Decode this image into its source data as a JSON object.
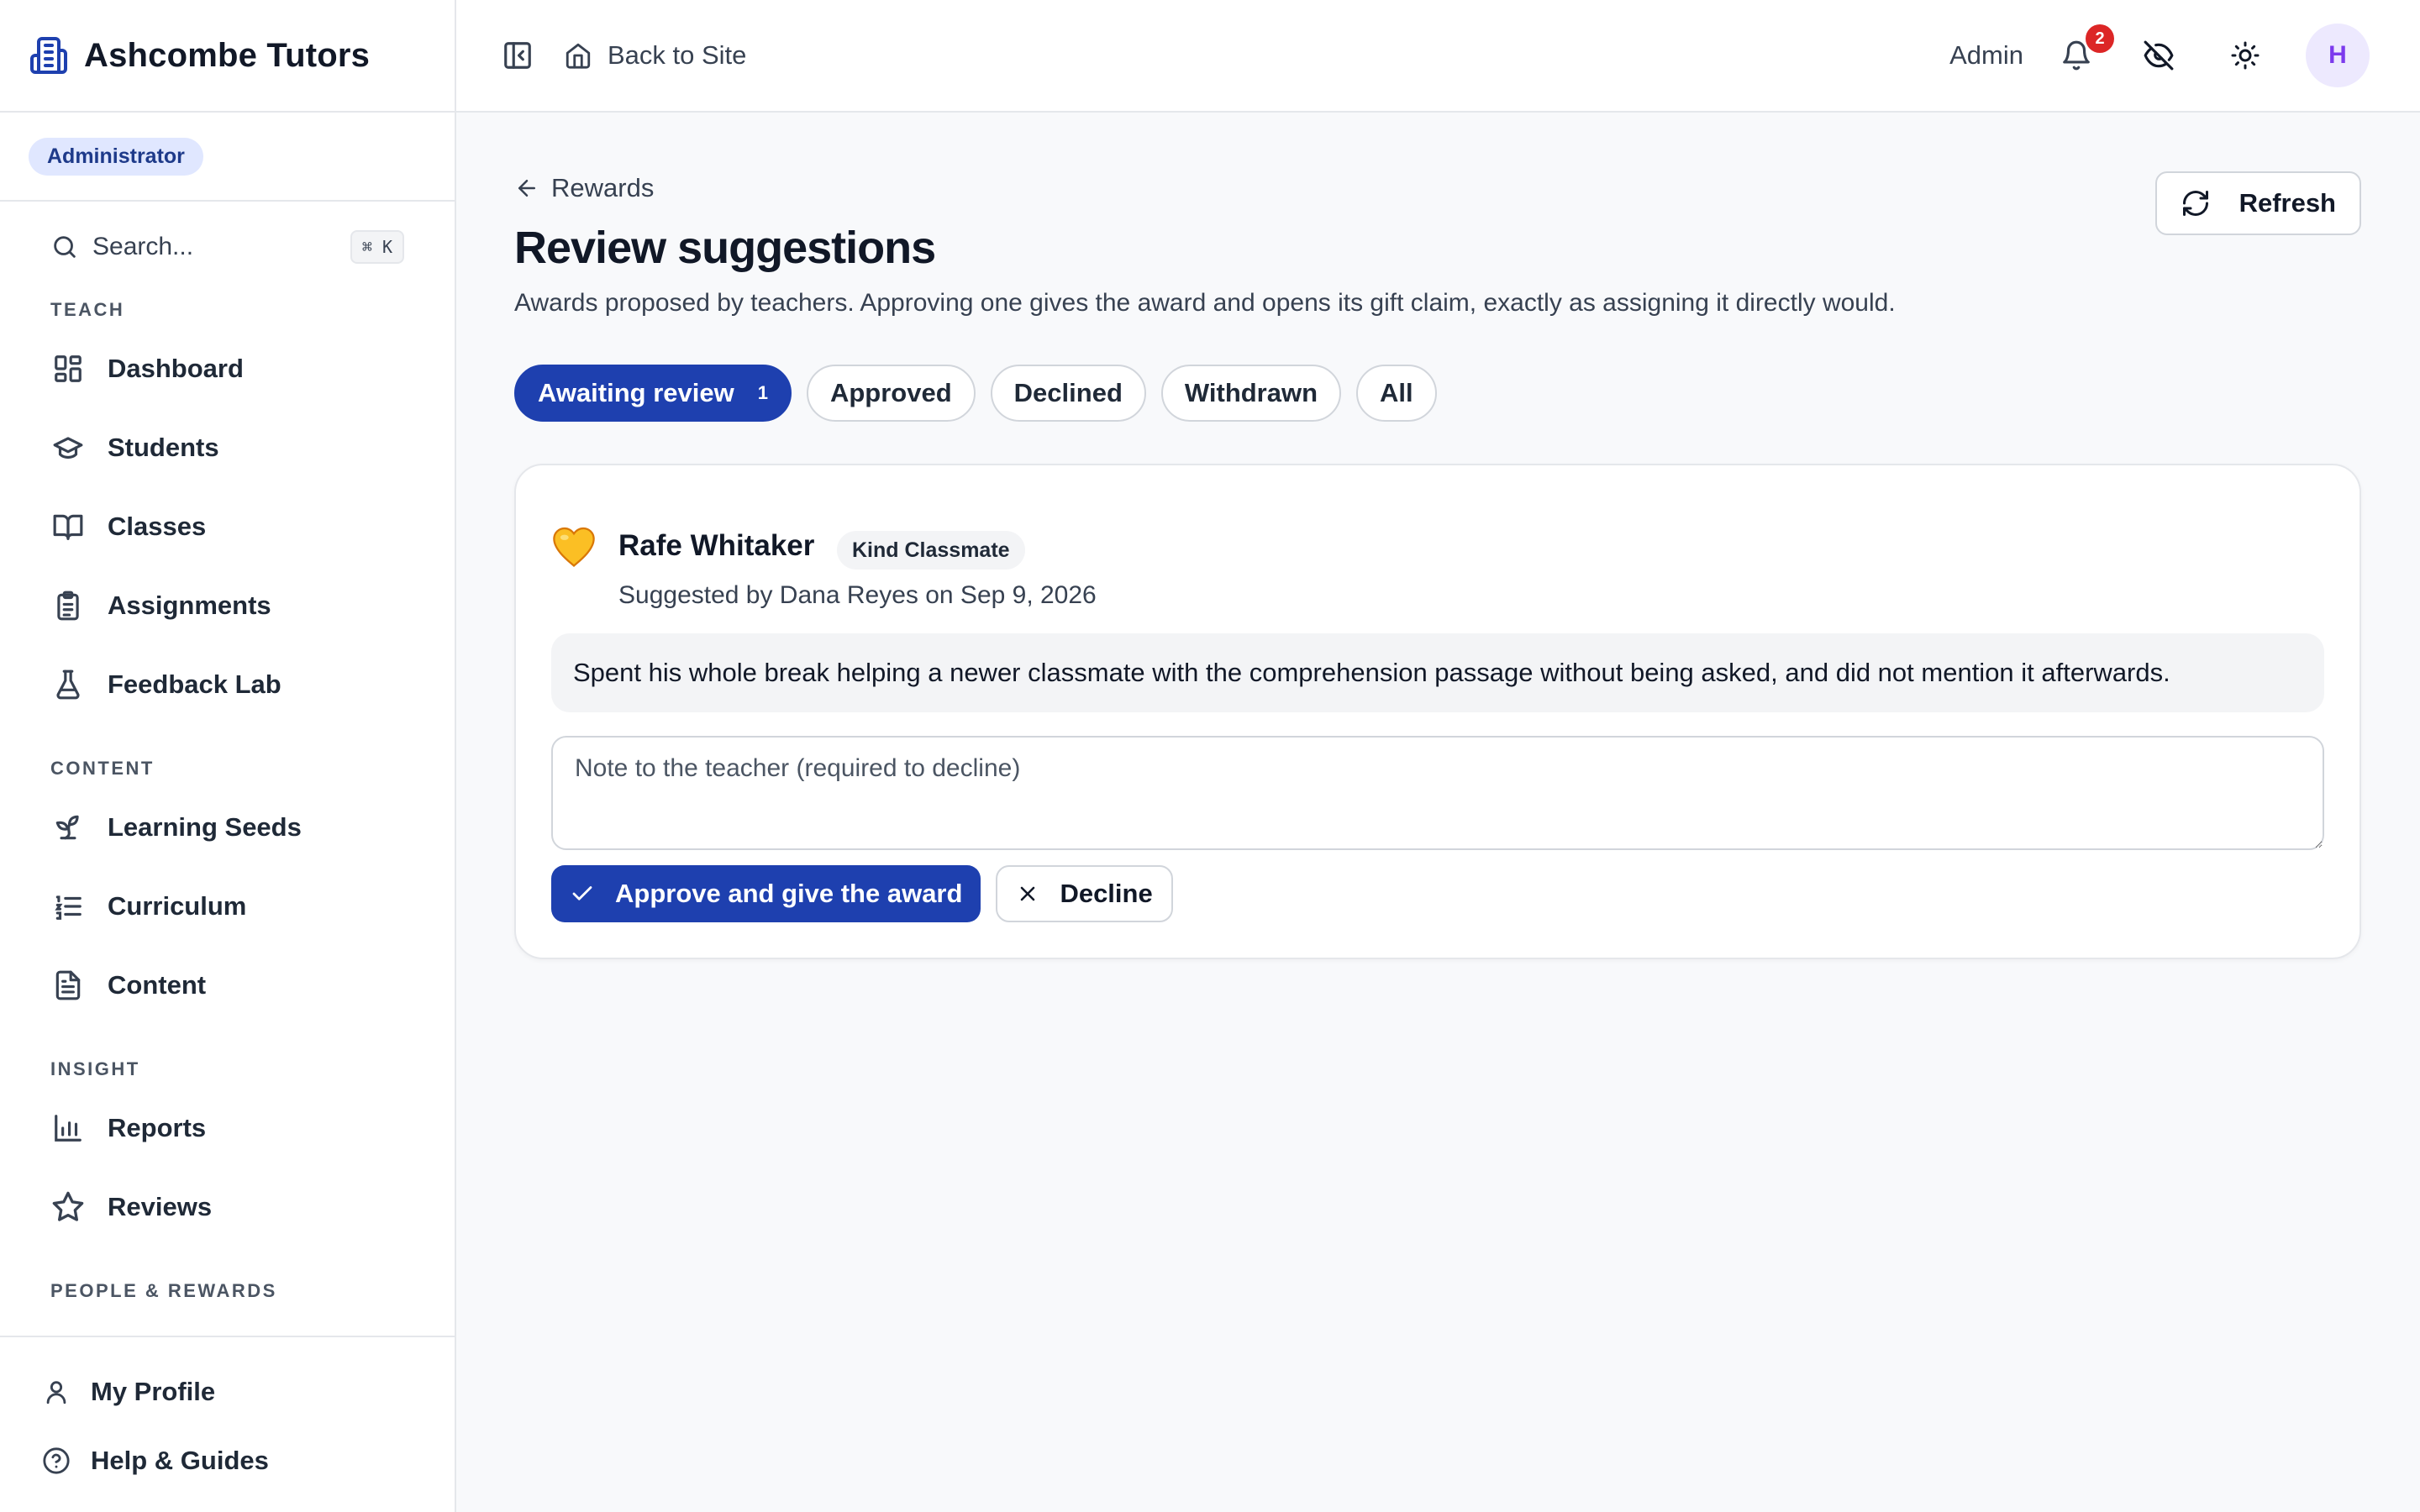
{
  "brand": {
    "name": "Ashcombe Tutors",
    "icon": "building-icon",
    "accent": "#1e40af"
  },
  "role": {
    "label": "Administrator"
  },
  "search": {
    "placeholder": "Search...",
    "shortcut": "⌘ K"
  },
  "sidebar": {
    "sections": [
      {
        "title": "TEACH",
        "items": [
          {
            "label": "Dashboard",
            "icon": "dashboard-icon"
          },
          {
            "label": "Students",
            "icon": "graduation-cap-icon"
          },
          {
            "label": "Classes",
            "icon": "book-open-icon"
          },
          {
            "label": "Assignments",
            "icon": "clipboard-icon"
          },
          {
            "label": "Feedback Lab",
            "icon": "flask-icon"
          }
        ]
      },
      {
        "title": "CONTENT",
        "items": [
          {
            "label": "Learning Seeds",
            "icon": "sprout-icon"
          },
          {
            "label": "Curriculum",
            "icon": "list-ordered-icon"
          },
          {
            "label": "Content",
            "icon": "file-text-icon"
          }
        ]
      },
      {
        "title": "INSIGHT",
        "items": [
          {
            "label": "Reports",
            "icon": "bar-chart-icon"
          },
          {
            "label": "Reviews",
            "icon": "star-icon"
          }
        ]
      },
      {
        "title": "PEOPLE & REWARDS",
        "items": []
      }
    ],
    "footer": [
      {
        "label": "My Profile",
        "icon": "user-icon"
      },
      {
        "label": "Help & Guides",
        "icon": "help-circle-icon"
      }
    ]
  },
  "topbar": {
    "back_label": "Back to Site",
    "admin_label": "Admin",
    "notification_count": "2",
    "avatar_initial": "H"
  },
  "page": {
    "breadcrumb": "Rewards",
    "title": "Review suggestions",
    "subtitle": "Awards proposed by teachers. Approving one gives the award and opens its gift claim, exactly as assigning it directly would.",
    "refresh_label": "Refresh"
  },
  "tabs": [
    {
      "label": "Awaiting review",
      "count": "1",
      "active": true
    },
    {
      "label": "Approved"
    },
    {
      "label": "Declined"
    },
    {
      "label": "Withdrawn"
    },
    {
      "label": "All"
    }
  ],
  "suggestion": {
    "student": "Rafe Whitaker",
    "award": "Kind Classmate",
    "award_icon": "yellow-heart-icon",
    "suggested_by": "Suggested by Dana Reyes on Sep 9, 2026",
    "reason": "Spent his whole break helping a newer classmate with the comprehension passage without being asked, and did not mention it afterwards.",
    "note_placeholder": "Note to the teacher (required to decline)",
    "approve_label": "Approve and give the award",
    "decline_label": "Decline"
  }
}
